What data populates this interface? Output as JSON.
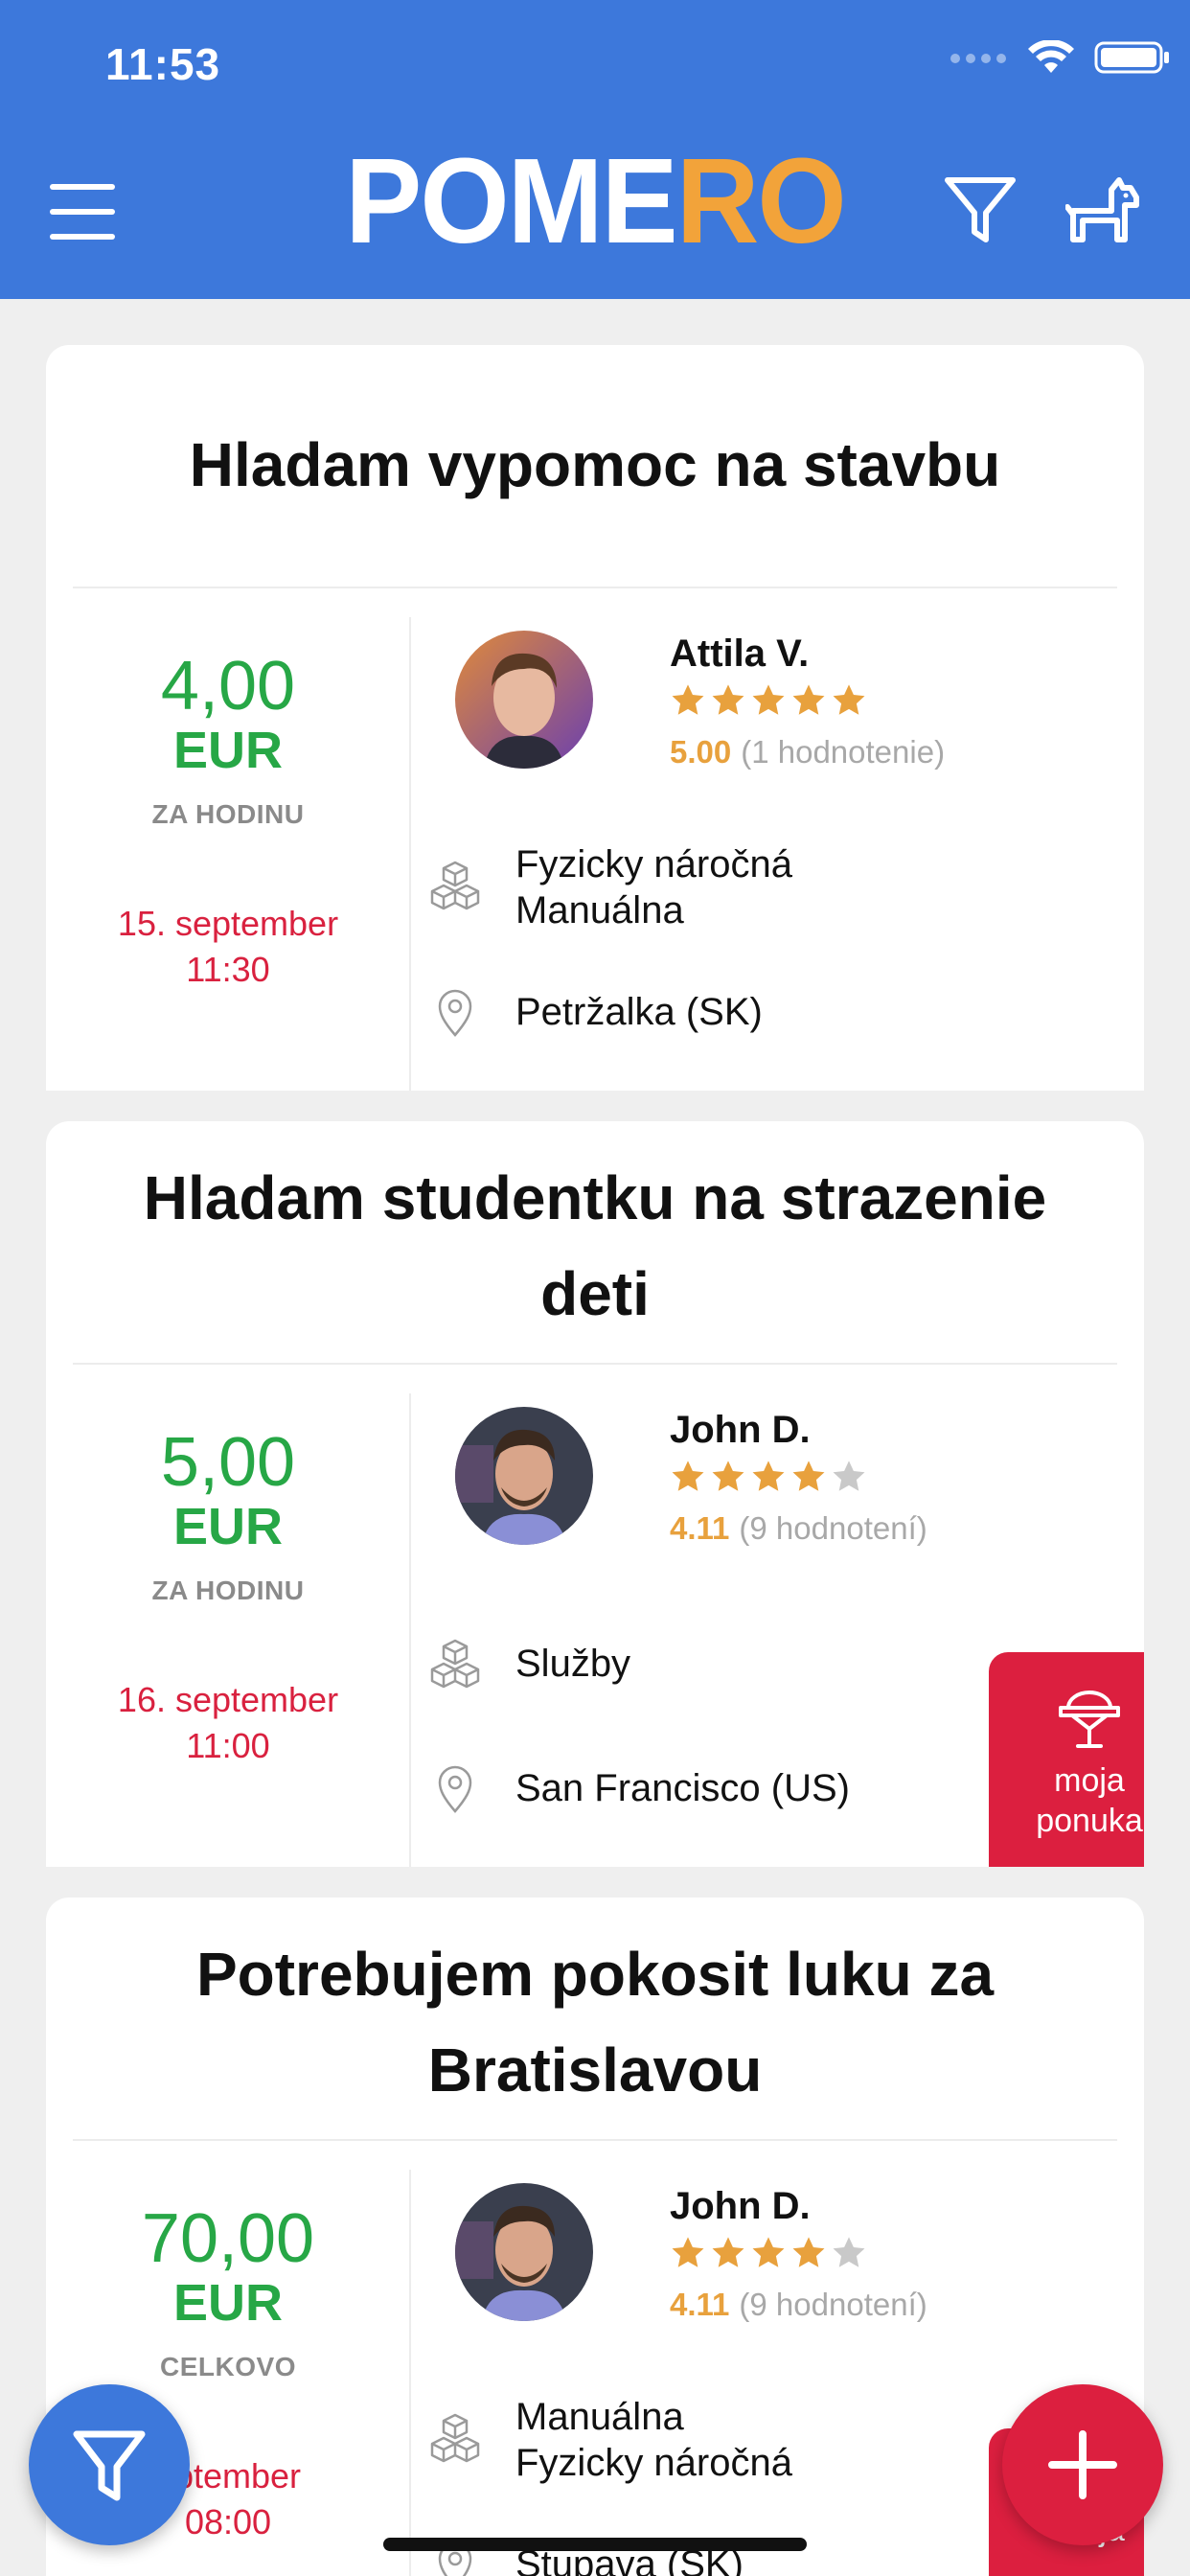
{
  "status_bar": {
    "time": "11:53"
  },
  "header": {
    "logo_part1": "POME",
    "logo_part2": "RO",
    "menu_icon": "hamburger-icon",
    "filter_icon": "filter-icon",
    "profile_icon": "dog-icon"
  },
  "colors": {
    "header_bg": "#3d78db",
    "logo_accent": "#f2a33a",
    "price_green": "#27a746",
    "date_red": "#d9213f",
    "rating_orange": "#e8a13d",
    "badge_red": "#dc1f3f"
  },
  "listings": [
    {
      "title": "Hladam vypomoc na stavbu",
      "price": "4,00",
      "currency": "EUR",
      "unit": "ZA HODINU",
      "date": "15. september",
      "time": "11:30",
      "user": {
        "name": "Attila V.",
        "rating": "5.00",
        "reviews": "(1 hodnotenie)",
        "stars": 5
      },
      "category_line1": "Fyzicky náročná",
      "category_line2": "Manuálna",
      "location": "Petržalka (SK)"
    },
    {
      "title": "Hladam studentku na strazenie deti",
      "price": "5,00",
      "currency": "EUR",
      "unit": "ZA HODINU",
      "date": "16. september",
      "time": "11:00",
      "user": {
        "name": "John D.",
        "rating": "4.11",
        "reviews": "(9 hodnotení)",
        "stars": 4
      },
      "category_line1": "Služby",
      "location": "San Francisco (US)",
      "badge_line1": "moja",
      "badge_line2": "ponuka"
    },
    {
      "title": "Potrebujem pokosit luku za Bratislavou",
      "price": "70,00",
      "currency": "EUR",
      "unit": "CELKOVO",
      "date": "eptember",
      "time": "08:00",
      "user": {
        "name": "John D.",
        "rating": "4.11",
        "reviews": "(9 hodnotení)",
        "stars": 4
      },
      "category_line1": "Manuálna",
      "category_line2": "Fyzicky náročná",
      "location": "Stupava (SK)",
      "badge_line1": "moja"
    }
  ],
  "fab": {
    "filter_icon": "filter-icon",
    "add_icon": "plus-icon"
  }
}
